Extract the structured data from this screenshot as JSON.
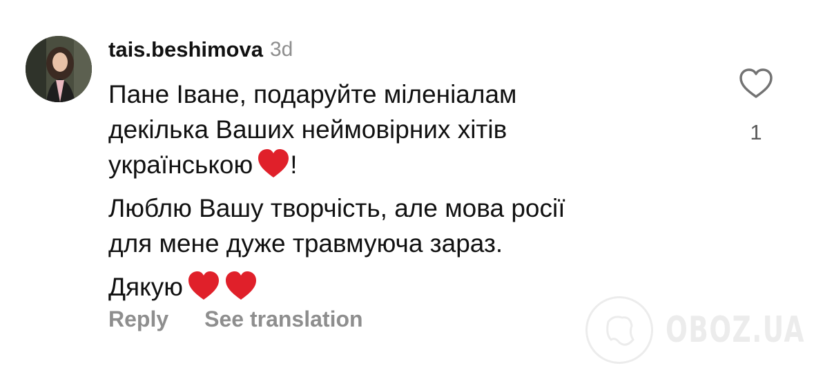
{
  "comment": {
    "username": "tais.beshimova",
    "time_ago": "3d",
    "paragraphs": [
      "Пане Іване, подаруйте міленіалам",
      "декілька Ваших неймовірних хітів",
      "українською",
      "!",
      "Люблю Вашу творчість, але мова росії",
      "для мене дуже травмуюча зараз.",
      "Дякую"
    ],
    "like_count": "1",
    "heart_color": "#e0202a"
  },
  "actions": {
    "reply_label": "Reply",
    "see_translation_label": "See translation"
  },
  "watermark": {
    "text": "OBOZ.UA"
  }
}
